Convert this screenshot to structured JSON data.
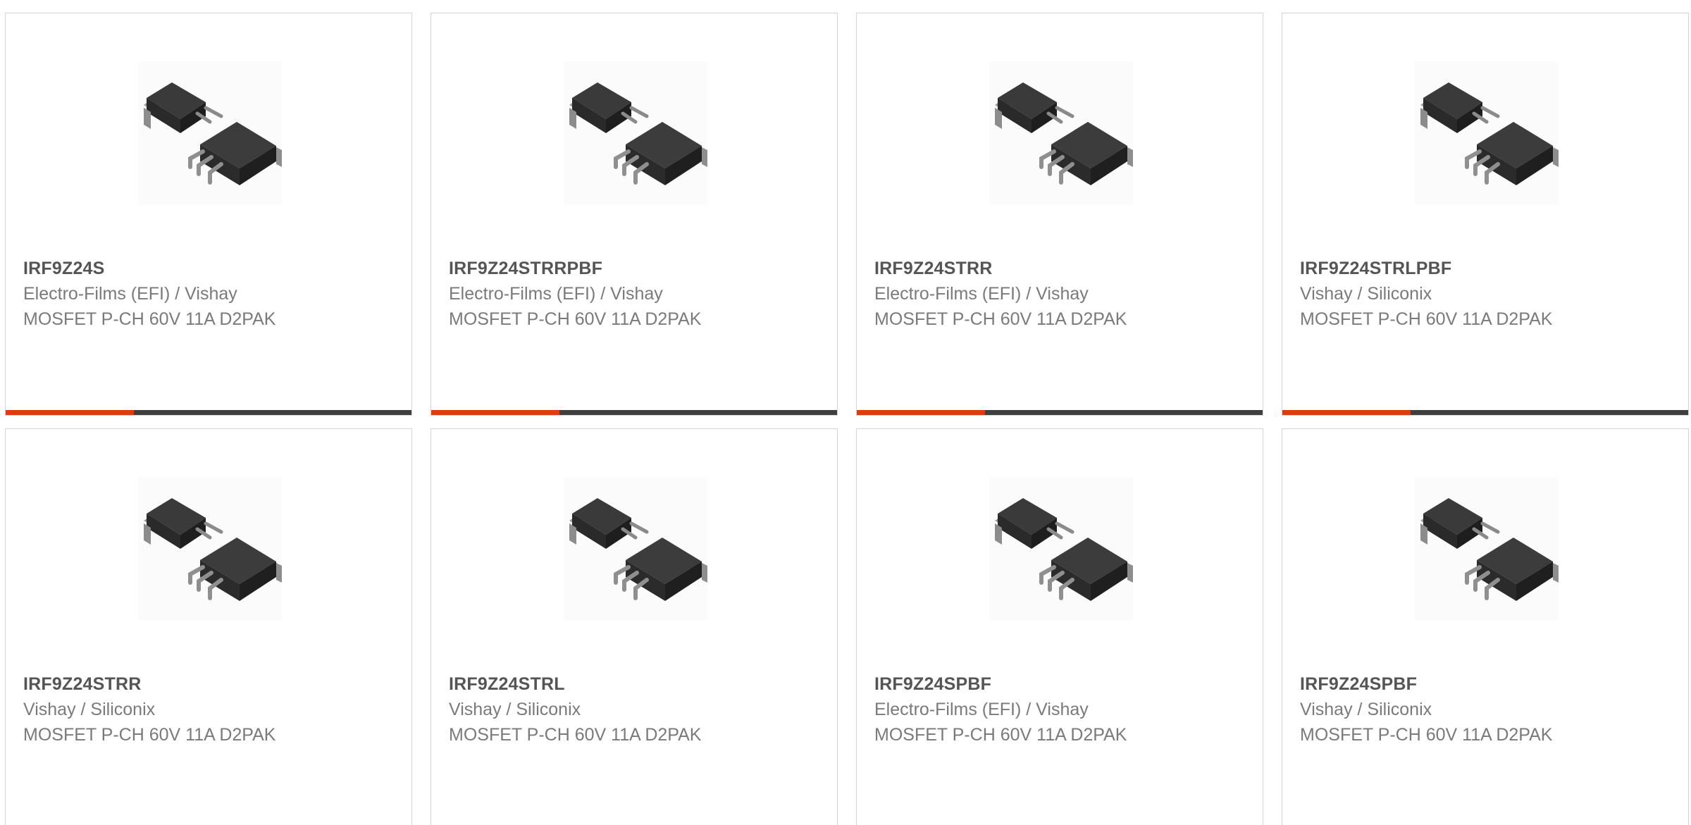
{
  "colors": {
    "accent": "#e03a0e",
    "bar": "#3f3f3f",
    "border": "#d4d4d4",
    "title": "#555555",
    "text": "#7a7a7a"
  },
  "products": [
    {
      "part": "IRF9Z24S",
      "manufacturer": "Electro-Films (EFI) / Vishay",
      "description": "MOSFET P-CH 60V 11A D2PAK",
      "image_icon": "d2pak-mosfet-icon"
    },
    {
      "part": "IRF9Z24STRRPBF",
      "manufacturer": "Electro-Films (EFI) / Vishay",
      "description": "MOSFET P-CH 60V 11A D2PAK",
      "image_icon": "d2pak-mosfet-icon"
    },
    {
      "part": "IRF9Z24STRR",
      "manufacturer": "Electro-Films (EFI) / Vishay",
      "description": "MOSFET P-CH 60V 11A D2PAK",
      "image_icon": "d2pak-mosfet-icon"
    },
    {
      "part": "IRF9Z24STRLPBF",
      "manufacturer": "Vishay / Siliconix",
      "description": "MOSFET P-CH 60V 11A D2PAK",
      "image_icon": "d2pak-mosfet-icon"
    },
    {
      "part": "IRF9Z24STRR",
      "manufacturer": "Vishay / Siliconix",
      "description": "MOSFET P-CH 60V 11A D2PAK",
      "image_icon": "d2pak-mosfet-icon"
    },
    {
      "part": "IRF9Z24STRL",
      "manufacturer": "Vishay / Siliconix",
      "description": "MOSFET P-CH 60V 11A D2PAK",
      "image_icon": "d2pak-mosfet-icon"
    },
    {
      "part": "IRF9Z24SPBF",
      "manufacturer": "Electro-Films (EFI) / Vishay",
      "description": "MOSFET P-CH 60V 11A D2PAK",
      "image_icon": "d2pak-mosfet-icon"
    },
    {
      "part": "IRF9Z24SPBF",
      "manufacturer": "Vishay / Siliconix",
      "description": "MOSFET P-CH 60V 11A D2PAK",
      "image_icon": "d2pak-mosfet-icon"
    }
  ]
}
